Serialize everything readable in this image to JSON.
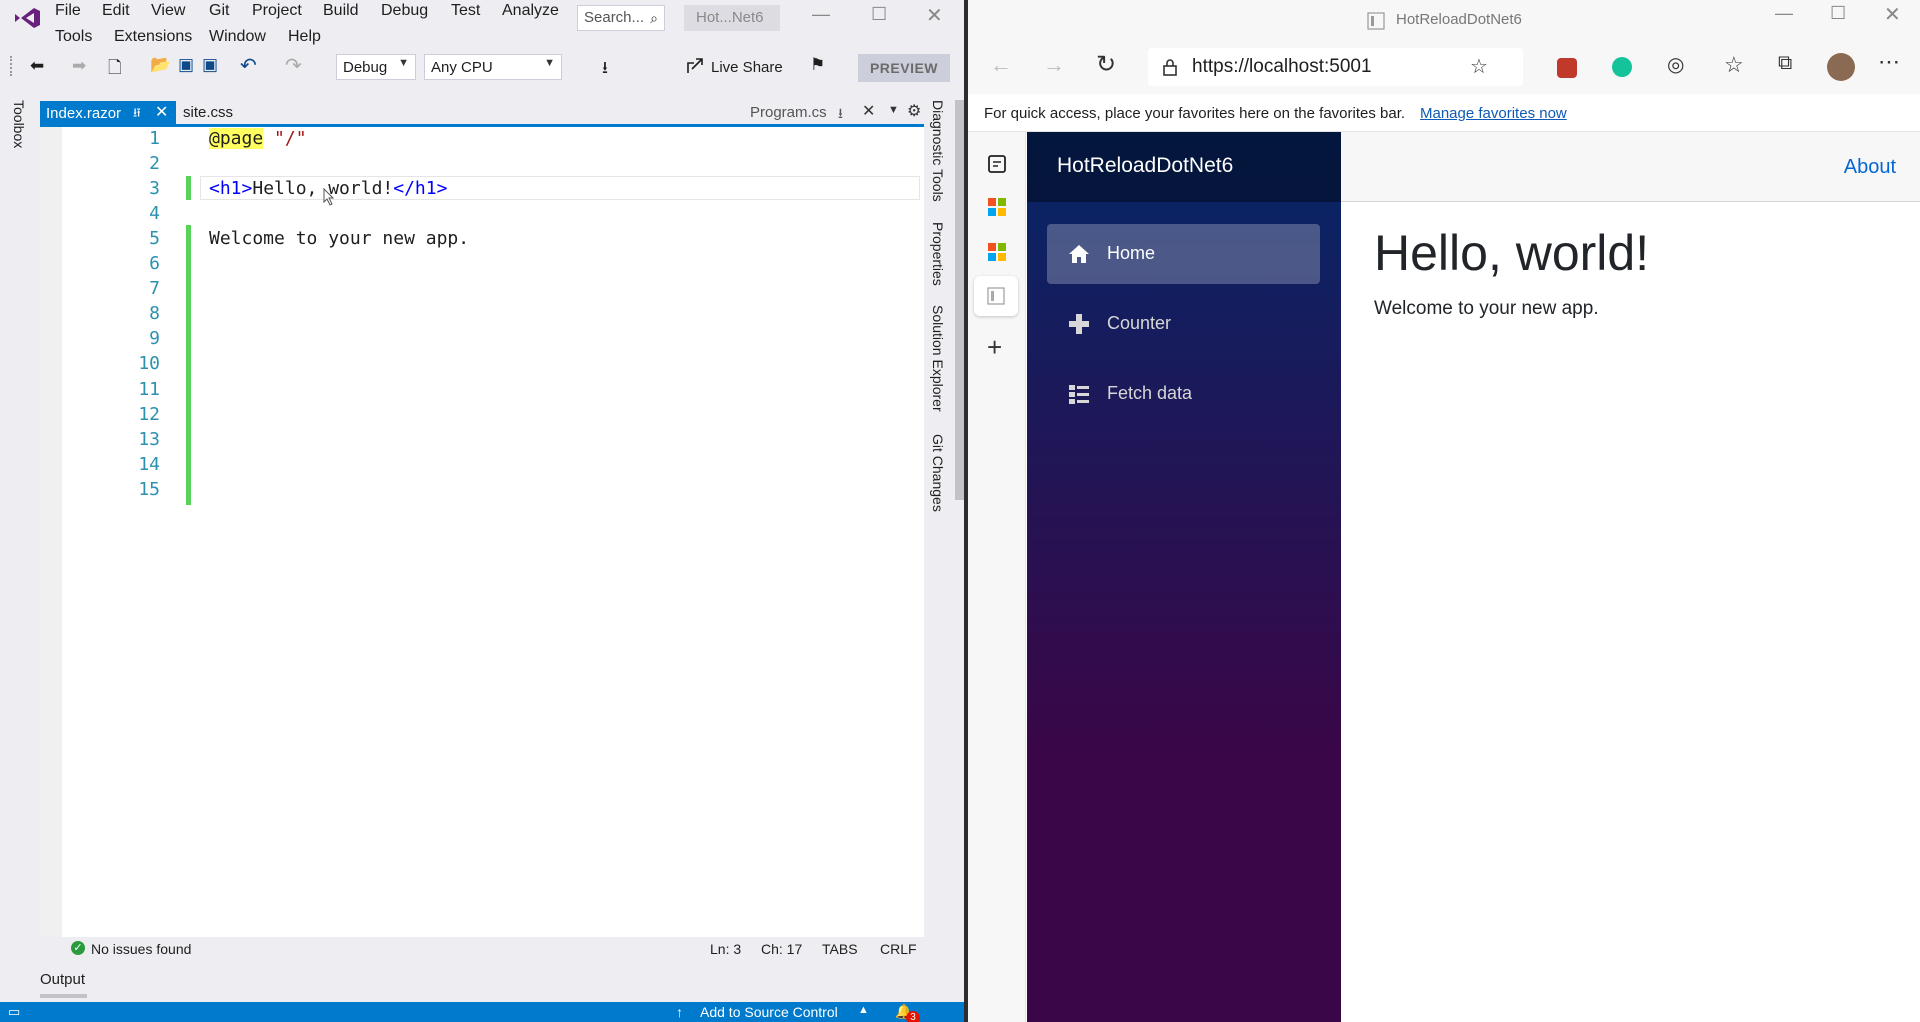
{
  "vs": {
    "menu_row1": [
      "File",
      "Edit",
      "View",
      "Git",
      "Project",
      "Build",
      "Debug",
      "Test",
      "Analyze"
    ],
    "menu_row2": [
      "Tools",
      "Extensions",
      "Window",
      "Help"
    ],
    "search_placeholder": "Search...",
    "window_title": "Hot...Net6",
    "config_combo": "Debug",
    "platform_combo": "Any CPU",
    "live_share": "Live Share",
    "preview": "PREVIEW",
    "toolbox": "Toolbox",
    "right_panels": [
      "Diagnostic Tools",
      "Properties",
      "Solution Explorer",
      "Git Changes"
    ],
    "tabs": {
      "active": "Index.razor",
      "second": "site.css",
      "preview_tab": "Program.cs"
    },
    "line_numbers": [
      "1",
      "2",
      "3",
      "4",
      "5",
      "6",
      "7",
      "8",
      "9",
      "10",
      "11",
      "12",
      "13",
      "14",
      "15"
    ],
    "code": {
      "line1_kw": "@page",
      "line1_str": "\"/\"",
      "line3_open": "<h1>",
      "line3_text": "Hello, world!",
      "line3_close": "</h1>",
      "line5": "Welcome to your new app."
    },
    "status": {
      "issues": "No issues found",
      "ln": "Ln: 3",
      "ch": "Ch: 17",
      "tabs": "TABS",
      "eol": "CRLF"
    },
    "output": "Output",
    "source_control": "Add to Source Control",
    "notif_count": "3"
  },
  "edge": {
    "title": "HotReloadDotNet6",
    "url": "https://localhost:5001",
    "fav_prompt": "For quick access, place your favorites here on the favorites bar.",
    "fav_link": "Manage favorites now"
  },
  "app": {
    "brand": "HotReloadDotNet6",
    "nav": [
      "Home",
      "Counter",
      "Fetch data"
    ],
    "about": "About",
    "heading": "Hello, world!",
    "body": "Welcome to your new app."
  },
  "colors": {
    "vs_accent": "#007acc",
    "code_keyword_highlight": "#ffff60",
    "modified_bar": "#57d35a",
    "link": "#0366d6"
  }
}
